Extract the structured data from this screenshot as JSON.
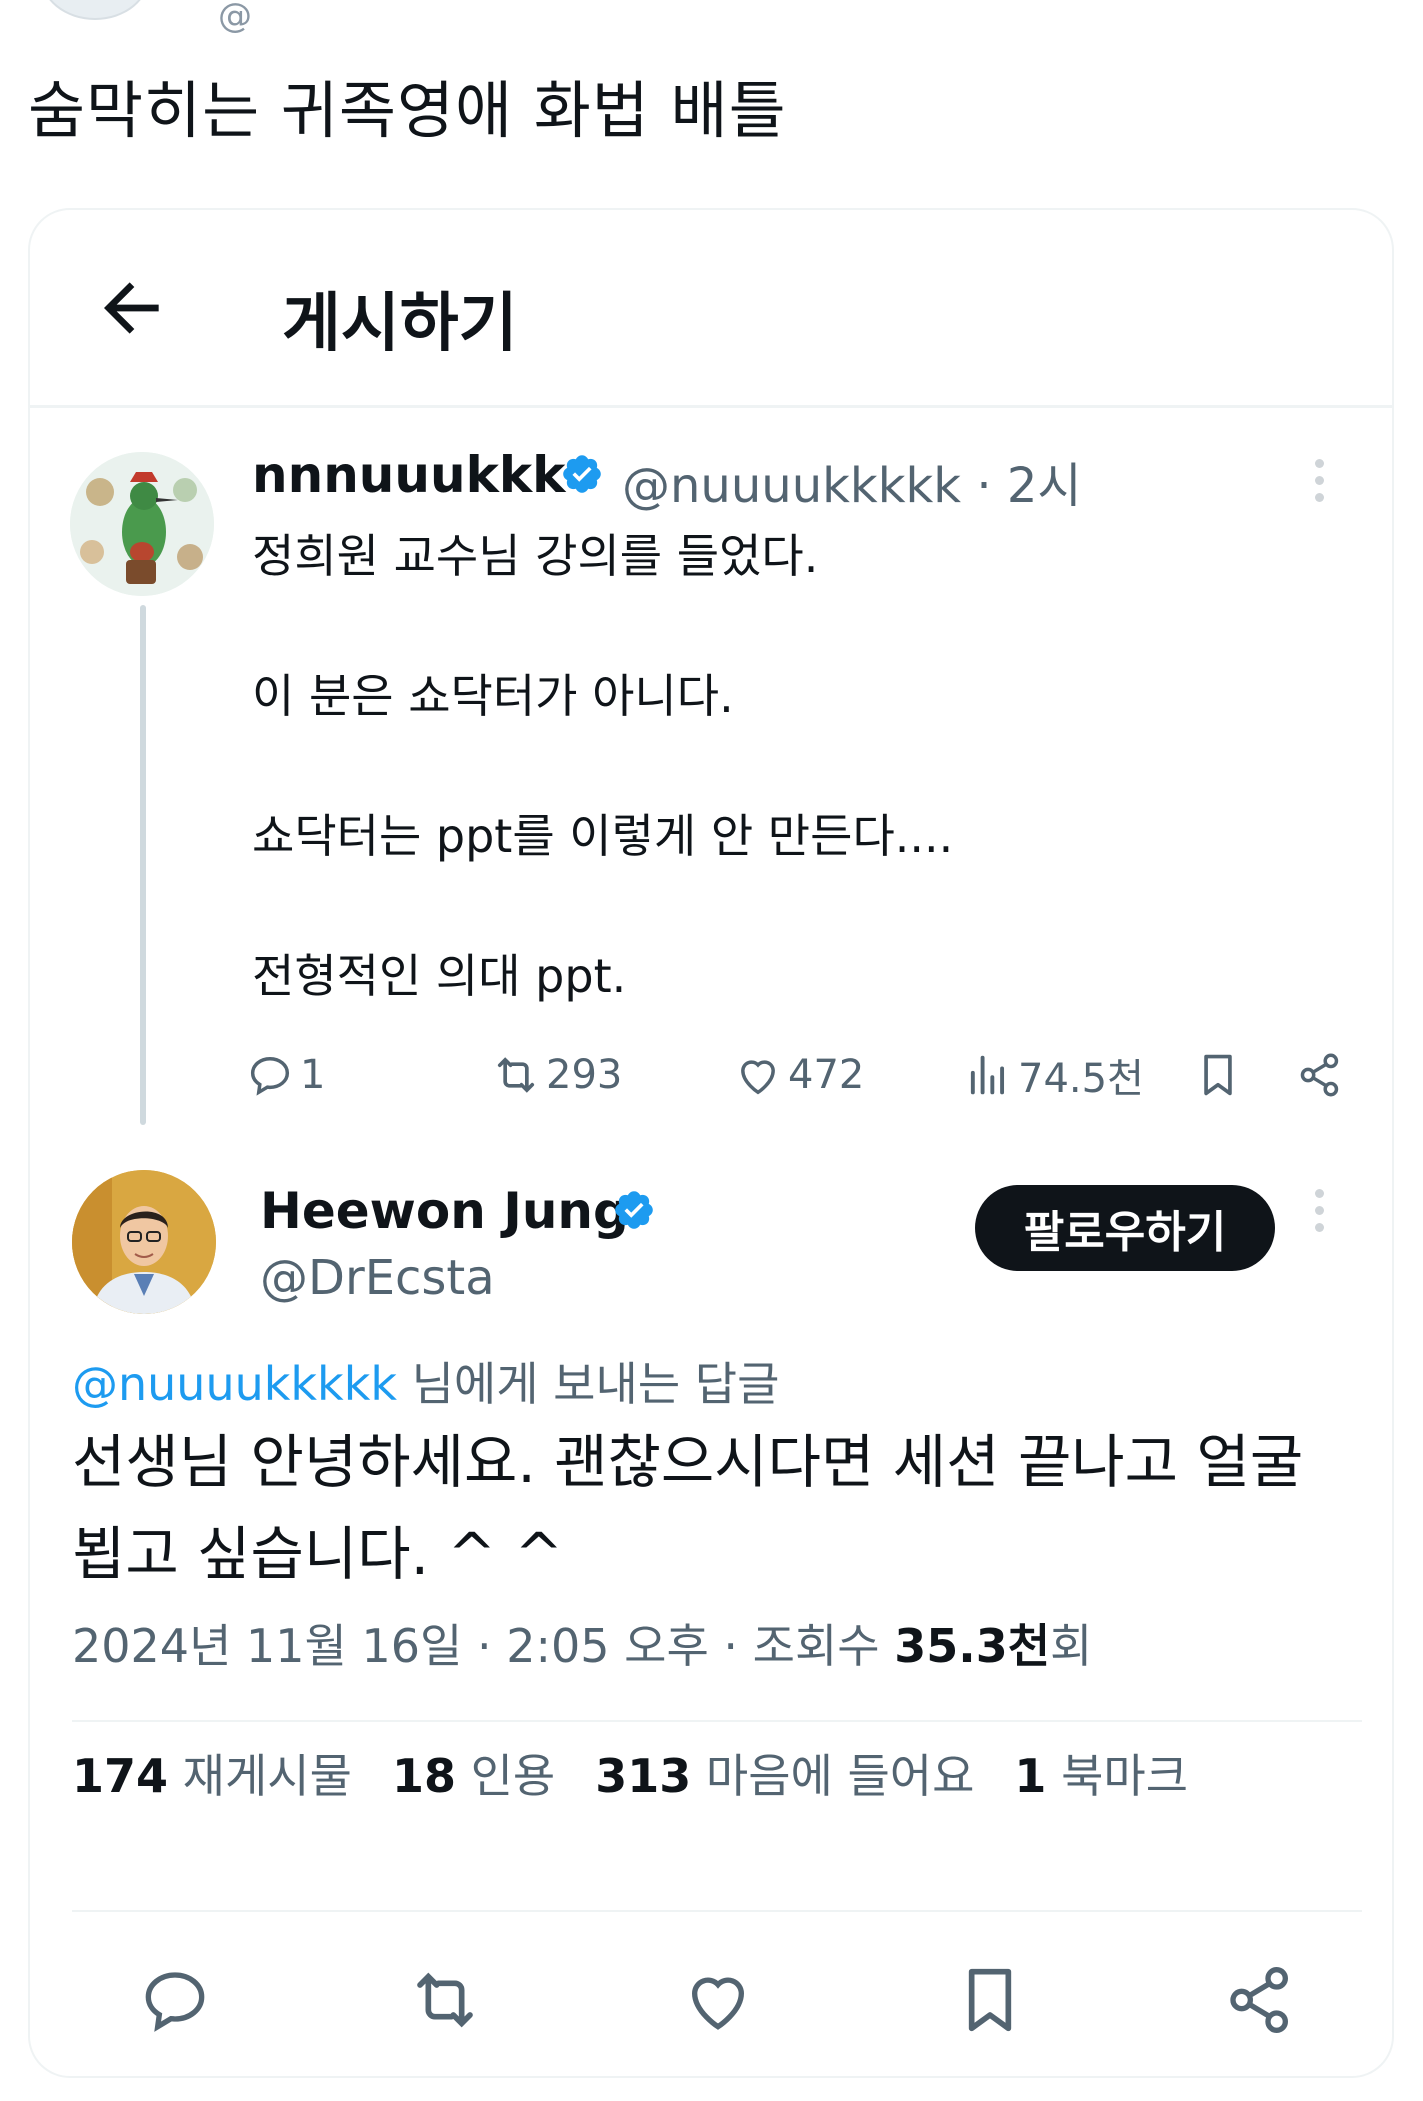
{
  "post_top": {
    "handle_partial": "@",
    "headline": "숨막히는 귀족영애 화법 배틀"
  },
  "header": {
    "title": "게시하기"
  },
  "tweet1": {
    "name": "nnnuuukkk",
    "handle": "@nuuuukkkkk",
    "time": "· 2시",
    "lines": [
      "정희원 교수님 강의를 들었다.",
      "이 분은 쇼닥터가 아니다.",
      "쇼닥터는 ppt를 이렇게 안 만든다....",
      "전형적인 의대 ppt."
    ],
    "replies": "1",
    "reposts": "293",
    "likes": "472",
    "views": "74.5천"
  },
  "tweet2": {
    "name": "Heewon Jung",
    "handle": "@DrEcsta",
    "follow_label": "팔로우하기",
    "replying_handle": "@nuuuukkkkk",
    "replying_suffix": " 님에게 보내는 답글",
    "text": "선생님 안녕하세요. 괜찮으시다면 세션 끝나고 얼굴 뵙고 싶습니다. ^ ^",
    "meta_prefix": "2024년 11월 16일 · 2:05 오후 · 조회수 ",
    "meta_views": "35.3천",
    "meta_suffix": "회",
    "stats": {
      "reposts_count": "174",
      "reposts_label": "재게시물",
      "quotes_count": "18",
      "quotes_label": "인용",
      "likes_count": "313",
      "likes_label": "마음에 들어요",
      "bookmarks_count": "1",
      "bookmarks_label": "북마크"
    }
  },
  "icons": {
    "back": "arrow-left-icon",
    "verified": "verified-badge-icon",
    "more": "more-vertical-icon",
    "reply": "reply-icon",
    "repost": "repost-icon",
    "like": "heart-icon",
    "views": "views-icon",
    "bookmark": "bookmark-icon",
    "share": "share-icon"
  },
  "colors": {
    "accent": "#1d9bf0",
    "text": "#0f1419",
    "muted": "#536471",
    "border": "#eff3f4"
  }
}
